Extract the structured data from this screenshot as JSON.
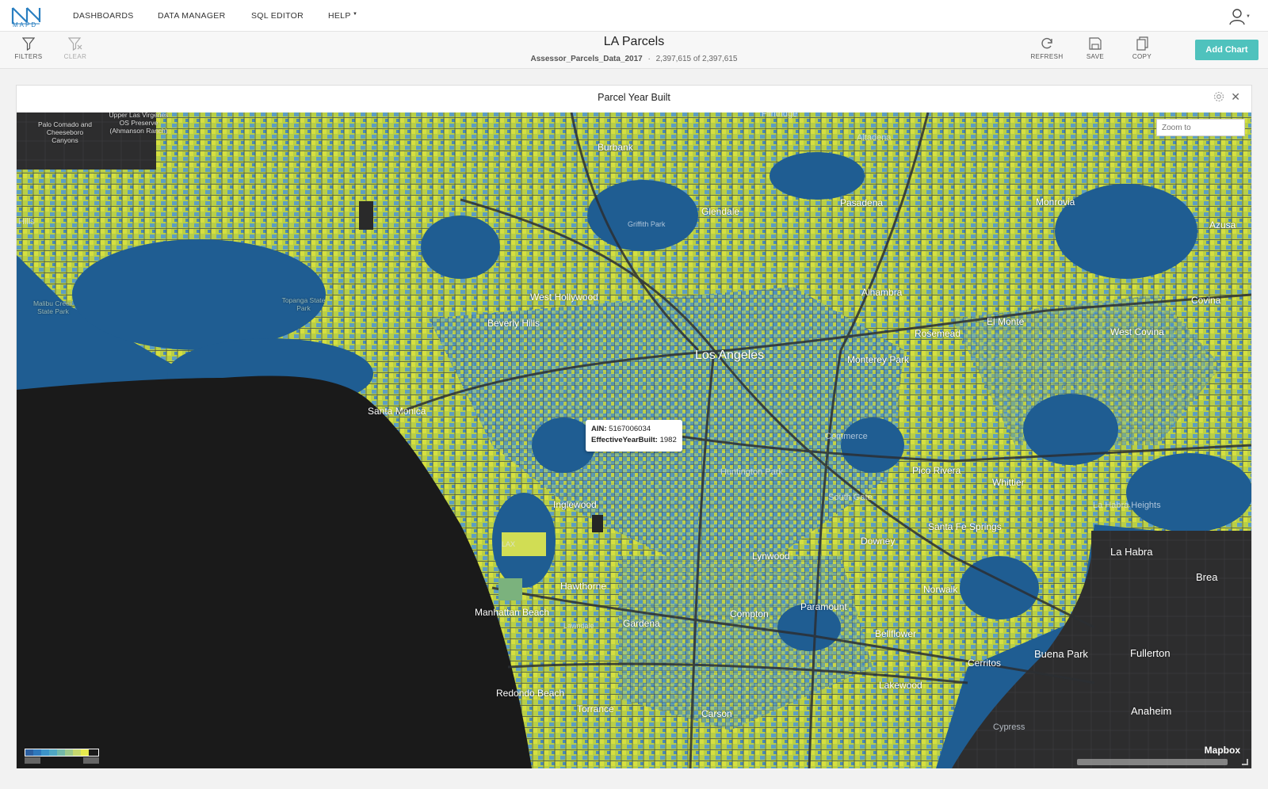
{
  "nav": {
    "logo_text": "MAPD",
    "items": [
      "DASHBOARDS",
      "DATA MANAGER",
      "SQL EDITOR",
      "HELP"
    ]
  },
  "toolbar": {
    "filters_label": "FILTERS",
    "clear_label": "CLEAR",
    "title": "LA Parcels",
    "source_table": "Assessor_Parcels_Data_2017",
    "separator": "·",
    "count_text": "2,397,615 of 2,397,615",
    "refresh_label": "REFRESH",
    "save_label": "SAVE",
    "copy_label": "COPY",
    "add_chart_label": "Add Chart"
  },
  "chart": {
    "title": "Parcel Year Built",
    "zoom_placeholder": "Zoom to",
    "tooltip": {
      "ain_key": "AIN:",
      "ain_value": "5167006034",
      "year_key": "EffectiveYearBuilt:",
      "year_value": "1982"
    },
    "attribution": "Mapbox",
    "legend_colors": [
      "#2c5fa0",
      "#2f78bb",
      "#3c93c8",
      "#4fa7c3",
      "#73b8a8",
      "#9cc88c",
      "#c6d86e",
      "#e6ea4d"
    ],
    "colors": {
      "water": "#1a1a1a",
      "base_blue": "#1f5d92",
      "parcel_yellow": "#c8d63e",
      "parcel_mid": "#5f9fbf",
      "dark_land": "#2b2b2b"
    },
    "places": {
      "palos": "Palo Comado and Cheeseboro Canyons",
      "upper_las": "Upper Las Virgenes OS Preserve (Ahmanson Ranch)",
      "burbank": "Burbank",
      "glendale": "Glendale",
      "pasadena": "Pasadena",
      "monrovia": "Monrovia",
      "azusa": "Azusa",
      "griffith": "Griffith Park",
      "west_hollywood": "West Hollywood",
      "beverly_hills": "Beverly Hills",
      "alhambra": "Alhambra",
      "el_monte": "El Monte",
      "rosemead": "Rosemead",
      "west_covina": "West Covina",
      "covina": "Covina",
      "los_angeles": "Los Angeles",
      "monterey_park": "Monterey Park",
      "malibu_creek": "Malibu Creek State Park",
      "topanga": "Topanga State Park",
      "santa_monica": "Santa Monica",
      "pico_rivera": "Pico Rivera",
      "whittier": "Whittier",
      "la_habra_heights": "La Habra Heights",
      "huntington_park": "Huntington Park",
      "inglewood": "Inglewood",
      "santa_fe_springs": "Santa Fe Springs",
      "downey": "Downey",
      "lynwood": "Lynwood",
      "la_habra": "La Habra",
      "brea": "Brea",
      "hawthorne": "Hawthorne",
      "norwalk": "Norwalk",
      "manhattan_beach": "Manhattan Beach",
      "compton": "Compton",
      "paramount": "Paramount",
      "gardena": "Gardena",
      "bellflower": "Bellflower",
      "lawndale": "Lawndale",
      "buena_park": "Buena Park",
      "fullerton": "Fullerton",
      "cerritos": "Cerritos",
      "redondo_beach": "Redondo Beach",
      "lakewood": "Lakewood",
      "torrance": "Torrance",
      "carson": "Carson",
      "anaheim": "Anaheim",
      "cypress": "Cypress",
      "commerce": "Commerce",
      "south_gate": "South Gate",
      "hills": "Hills",
      "lax": "LAX",
      "flintridge": "Flintridge",
      "altadena": "Altadena"
    }
  }
}
